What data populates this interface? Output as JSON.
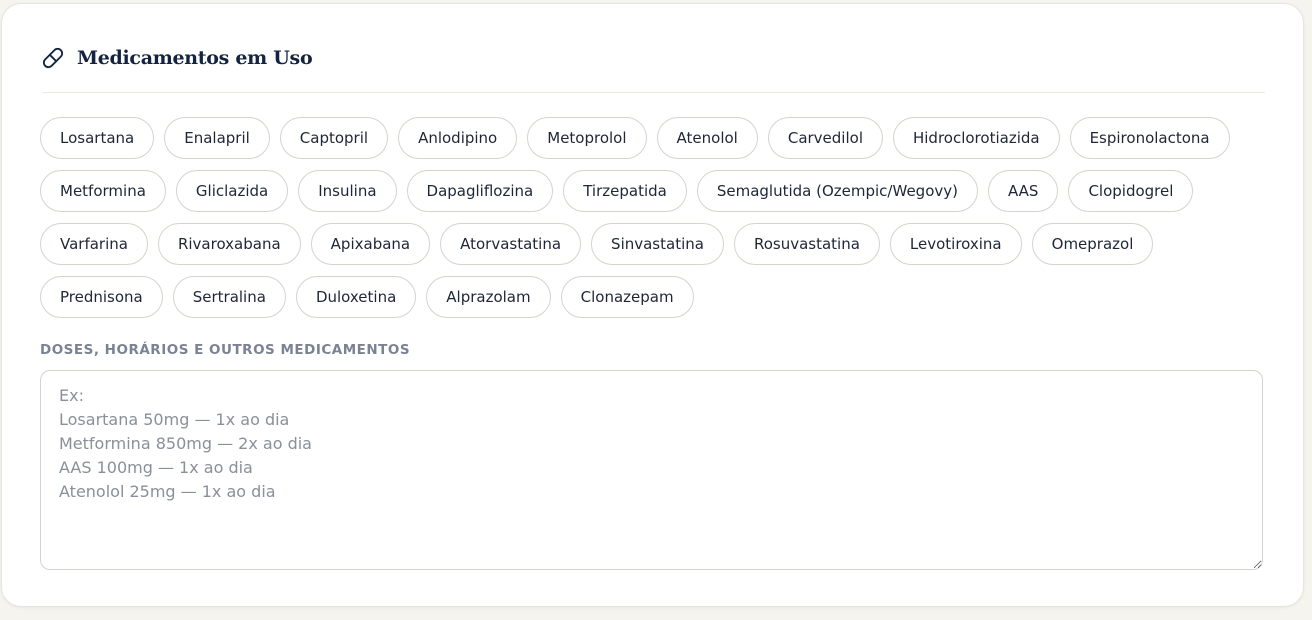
{
  "section": {
    "title": "Medicamentos em Uso",
    "icon": "pill-icon",
    "accent_color": "#14233f"
  },
  "chips": [
    {
      "label": "Losartana"
    },
    {
      "label": "Enalapril"
    },
    {
      "label": "Captopril"
    },
    {
      "label": "Anlodipino"
    },
    {
      "label": "Metoprolol"
    },
    {
      "label": "Atenolol"
    },
    {
      "label": "Carvedilol"
    },
    {
      "label": "Hidroclorotiazida"
    },
    {
      "label": "Espironolactona"
    },
    {
      "label": "Metformina"
    },
    {
      "label": "Gliclazida"
    },
    {
      "label": "Insulina"
    },
    {
      "label": "Dapagliflozina"
    },
    {
      "label": "Tirzepatida"
    },
    {
      "label": "Semaglutida (Ozempic/Wegovy)"
    },
    {
      "label": "AAS"
    },
    {
      "label": "Clopidogrel"
    },
    {
      "label": "Varfarina"
    },
    {
      "label": "Rivaroxabana"
    },
    {
      "label": "Apixabana"
    },
    {
      "label": "Atorvastatina"
    },
    {
      "label": "Sinvastatina"
    },
    {
      "label": "Rosuvastatina"
    },
    {
      "label": "Levotiroxina"
    },
    {
      "label": "Omeprazol"
    },
    {
      "label": "Prednisona"
    },
    {
      "label": "Sertralina"
    },
    {
      "label": "Duloxetina"
    },
    {
      "label": "Alprazolam"
    },
    {
      "label": "Clonazepam"
    }
  ],
  "doses": {
    "label": "DOSES, HORÁRIOS E OUTROS MEDICAMENTOS",
    "value": "",
    "placeholder": "Ex:\nLosartana 50mg — 1x ao dia\nMetformina 850mg — 2x ao dia\nAAS 100mg — 1x ao dia\nAtenolol 25mg — 1x ao dia"
  }
}
